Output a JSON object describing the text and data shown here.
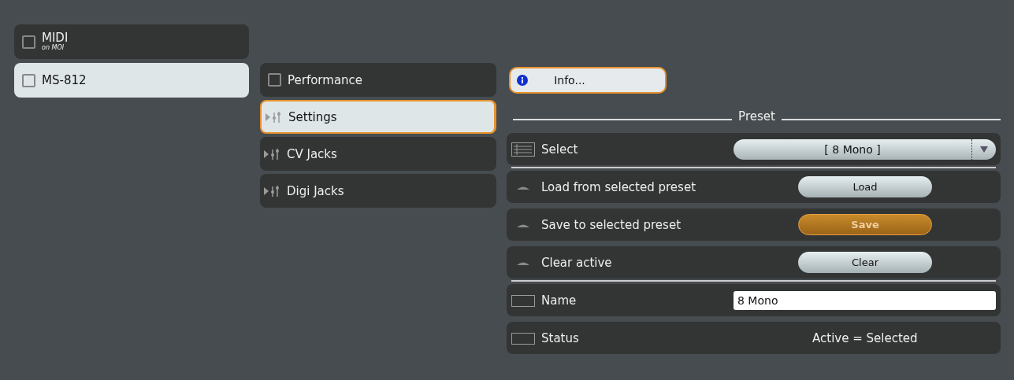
{
  "devices": [
    {
      "label": "MIDI",
      "sublabel": "on MOI",
      "selected": false
    },
    {
      "label": "MS-812",
      "selected": true
    }
  ],
  "sections": [
    {
      "kind": "checkbox",
      "label": "Performance",
      "selected": false
    },
    {
      "kind": "folder",
      "label": "Settings",
      "selected": true
    },
    {
      "kind": "folder",
      "label": "CV Jacks",
      "selected": false
    },
    {
      "kind": "folder",
      "label": "Digi Jacks",
      "selected": false
    }
  ],
  "info_button": {
    "label": "Info..."
  },
  "group_title": "Preset",
  "rows": [
    {
      "kind": "select",
      "label": "Select",
      "value": "[ 8 Mono ]",
      "divider_after": true
    },
    {
      "kind": "button",
      "label": "Load from selected preset",
      "button": "Load",
      "highlighted": false
    },
    {
      "kind": "button",
      "label": "Save to selected preset",
      "button": "Save",
      "highlighted": true
    },
    {
      "kind": "button",
      "label": "Clear active",
      "button": "Clear",
      "highlighted": false,
      "divider_after": true
    },
    {
      "kind": "field",
      "label": "Name",
      "value": "8 Mono"
    },
    {
      "kind": "status",
      "label": "Status",
      "value": "Active = Selected"
    }
  ]
}
